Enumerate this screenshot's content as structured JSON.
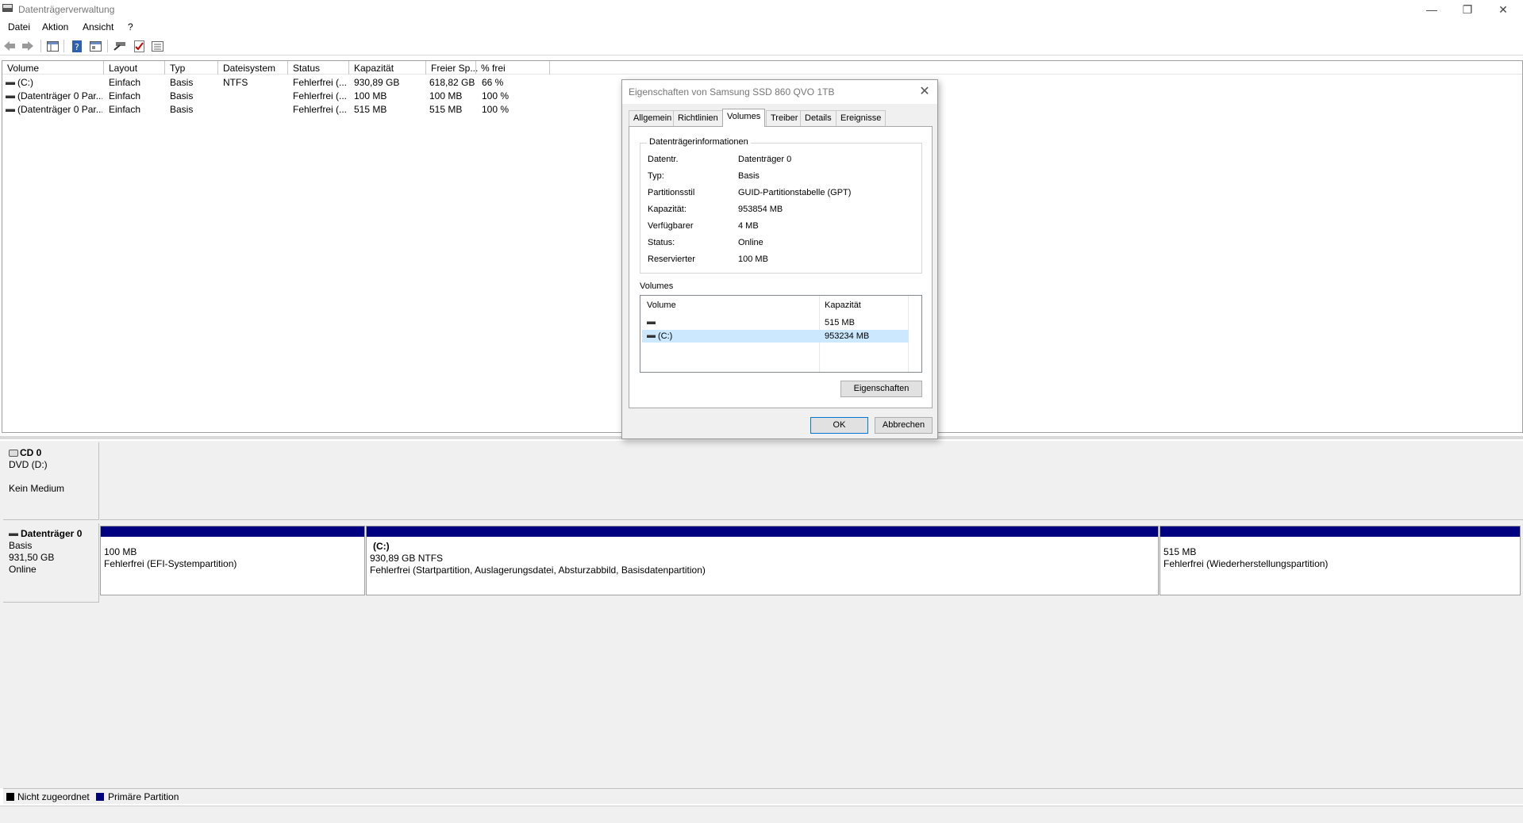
{
  "window": {
    "title": "Datenträgerverwaltung",
    "controls": {
      "minimize": "—",
      "restore": "❐",
      "close": "✕"
    }
  },
  "menu": [
    "Datei",
    "Aktion",
    "Ansicht",
    "?"
  ],
  "toolbar": {
    "icons": [
      "back-arrow-icon",
      "forward-arrow-icon",
      "show-hide-console-tree-icon",
      "help-icon",
      "properties-view-icon",
      "connect-icon",
      "check-icon",
      "list-view-icon"
    ]
  },
  "volume_list": {
    "columns": [
      "Volume",
      "Layout",
      "Typ",
      "Dateisystem",
      "Status",
      "Kapazität",
      "Freier Sp...",
      "% frei"
    ],
    "rows": [
      {
        "volume": "(C:)",
        "layout": "Einfach",
        "typ": "Basis",
        "dateisystem": "NTFS",
        "status": "Fehlerfrei (...",
        "kapazitaet": "930,89 GB",
        "frei": "618,82 GB",
        "prozent": "66 %"
      },
      {
        "volume": "(Datenträger 0 Par...",
        "layout": "Einfach",
        "typ": "Basis",
        "dateisystem": "",
        "status": "Fehlerfrei (...",
        "kapazitaet": "100 MB",
        "frei": "100 MB",
        "prozent": "100 %"
      },
      {
        "volume": "(Datenträger 0 Par...",
        "layout": "Einfach",
        "typ": "Basis",
        "dateisystem": "",
        "status": "Fehlerfrei (...",
        "kapazitaet": "515 MB",
        "frei": "515 MB",
        "prozent": "100 %"
      }
    ]
  },
  "graphical": {
    "cd": {
      "name": "CD 0",
      "drive": "DVD (D:)",
      "status": "Kein Medium"
    },
    "disk0": {
      "name": "Datenträger 0",
      "type": "Basis",
      "size": "931,50 GB",
      "status": "Online",
      "partitions": [
        {
          "title": "",
          "line1": "100 MB",
          "line2": "Fehlerfrei (EFI-Systempartition)"
        },
        {
          "title": "(C:)",
          "line1": "930,89 GB NTFS",
          "line2": "Fehlerfrei (Startpartition, Auslagerungsdatei, Absturzabbild, Basisdatenpartition)"
        },
        {
          "title": "",
          "line1": "515 MB",
          "line2": "Fehlerfrei (Wiederherstellungspartition)"
        }
      ]
    }
  },
  "legend": [
    {
      "label": "Nicht zugeordnet",
      "color": "#000000"
    },
    {
      "label": "Primäre Partition",
      "color": "#000080"
    }
  ],
  "dialog": {
    "title": "Eigenschaften von Samsung SSD 860 QVO 1TB",
    "close": "✕",
    "tabs": [
      "Allgemein",
      "Richtlinien",
      "Volumes",
      "Treiber",
      "Details",
      "Ereignisse"
    ],
    "active_tab": "Volumes",
    "group_title": "Datenträgerinformationen",
    "info": [
      {
        "key": "Datentr.",
        "value": "Datenträger 0"
      },
      {
        "key": "Typ:",
        "value": "Basis"
      },
      {
        "key": "Partitionsstil",
        "value": "GUID-Partitionstabelle (GPT)"
      },
      {
        "key": "Kapazität:",
        "value": "953854 MB"
      },
      {
        "key": "Verfügbarer",
        "value": "4 MB"
      },
      {
        "key": "Status:",
        "value": "Online"
      },
      {
        "key": "Reservierter",
        "value": "100 MB"
      }
    ],
    "volumes_label": "Volumes",
    "volumes_columns": [
      "Volume",
      "Kapazität"
    ],
    "volumes_rows": [
      {
        "volume": "",
        "capacity": "515 MB",
        "selected": false
      },
      {
        "volume": "(C:)",
        "capacity": "953234 MB",
        "selected": true
      }
    ],
    "properties_button": "Eigenschaften",
    "ok_button": "OK",
    "cancel_button": "Abbrechen"
  }
}
